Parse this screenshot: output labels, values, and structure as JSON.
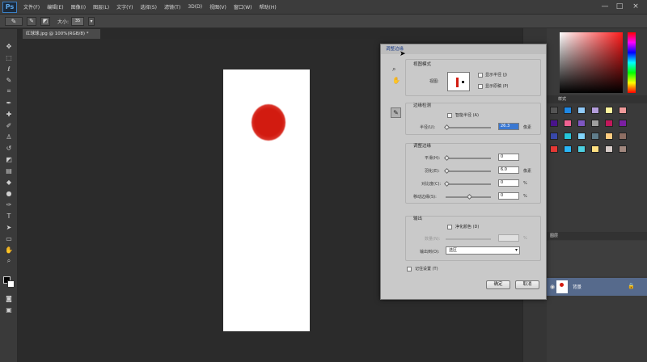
{
  "app": {
    "logo": "Ps"
  },
  "menubar": {
    "items": [
      "文件(F)",
      "编辑(E)",
      "图像(I)",
      "图层(L)",
      "文字(Y)",
      "选择(S)",
      "滤镜(T)",
      "3D(D)",
      "视图(V)",
      "窗口(W)",
      "帮助(H)"
    ]
  },
  "window_controls": [
    "—",
    "□",
    "×"
  ],
  "options_bar": {
    "size_label": "大小:",
    "size_value": "35"
  },
  "document_tab": {
    "title": "红球球.jpg @ 100%(RGB/8) *"
  },
  "dialog": {
    "title": "调整边缘",
    "view_mode": {
      "heading": "视图模式",
      "view_label": "视图:",
      "show_radius": "显示半径 (J)",
      "show_original": "显示原稿 (P)"
    },
    "edge_detection": {
      "heading": "边缘检测",
      "smart_radius": "智能半径 (A)",
      "radius_label": "半径(U):",
      "radius_value": "26.3",
      "radius_unit": "像素"
    },
    "adjust_edge": {
      "heading": "调整边缘",
      "rows": [
        {
          "label": "平滑(H):",
          "value": "0",
          "unit": ""
        },
        {
          "label": "羽化(E):",
          "value": "6.0",
          "unit": "像素"
        },
        {
          "label": "对比度(C):",
          "value": "0",
          "unit": "%"
        },
        {
          "label": "移动边缘(S):",
          "value": "0",
          "unit": "%"
        }
      ]
    },
    "output": {
      "heading": "输出",
      "decontaminate": "净化颜色 (D)",
      "amount_label": "数量(N):",
      "amount_unit": "%",
      "output_to_label": "输出到(O):",
      "output_to_value": "选区"
    },
    "remember": "记住设置 (T)",
    "ok": "确定",
    "cancel": "取消"
  },
  "panels": {
    "tab_label": "样式",
    "layers_tab": "图层",
    "layer_name": "背景"
  },
  "colors": {
    "accent": "#1c3c86",
    "red_ball": "#d21b10",
    "layer_selected": "#566a8c"
  }
}
